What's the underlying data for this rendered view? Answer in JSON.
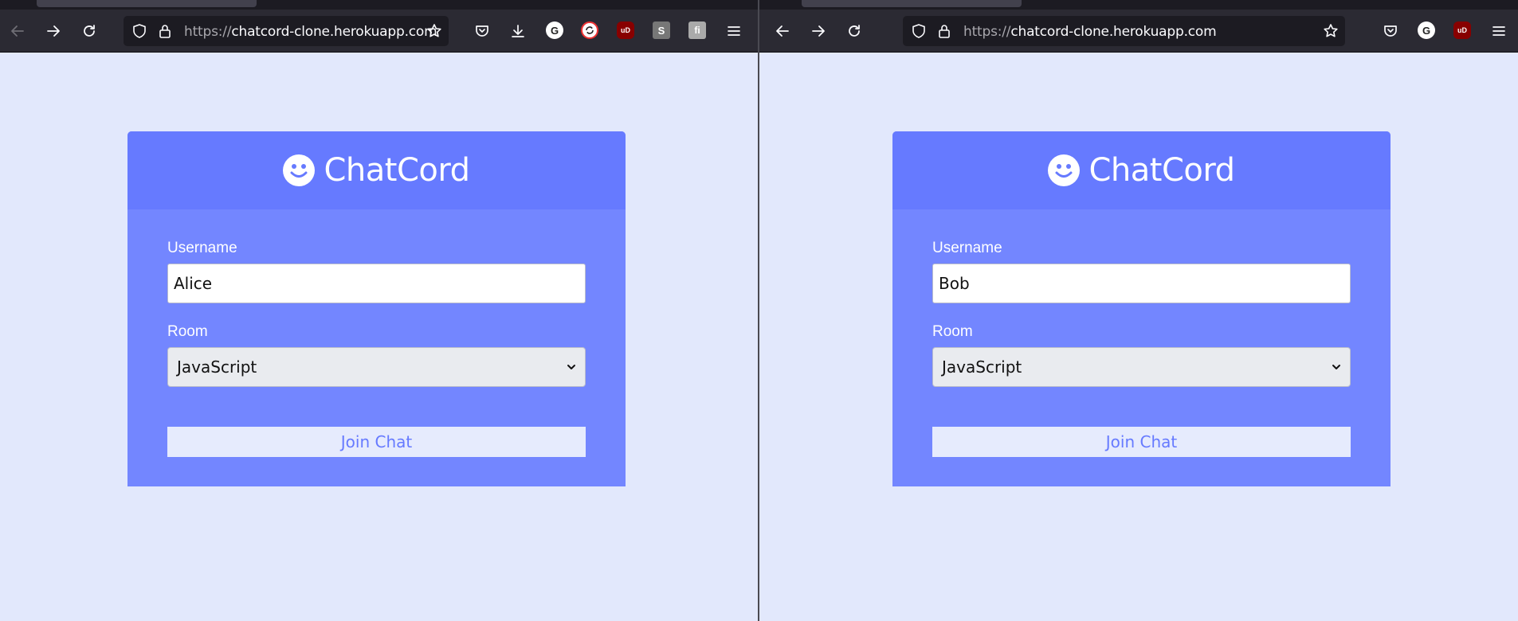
{
  "windows": [
    {
      "url": {
        "scheme": "https://",
        "host": "chatcord-clone.herokuapp.com"
      },
      "app": {
        "title": "ChatCord"
      },
      "form": {
        "username_label": "Username",
        "username_value": "Alice",
        "room_label": "Room",
        "room_value": "JavaScript",
        "join_label": "Join Chat"
      }
    },
    {
      "url": {
        "scheme": "https://",
        "host": "chatcord-clone.herokuapp.com"
      },
      "app": {
        "title": "ChatCord"
      },
      "form": {
        "username_label": "Username",
        "username_value": "Bob",
        "room_label": "Room",
        "room_value": "JavaScript",
        "join_label": "Join Chat"
      }
    }
  ],
  "extensions": {
    "grammarly_letter": "G",
    "ublock_letter": "uD",
    "s_letter": "S",
    "fi_letter": "fi"
  },
  "colors": {
    "page_bg": "#e2e8fc",
    "card_header": "#667aff",
    "card_body": "#7386ff",
    "button_bg": "#e6ebfd",
    "toolbar": "#2b2a33"
  }
}
